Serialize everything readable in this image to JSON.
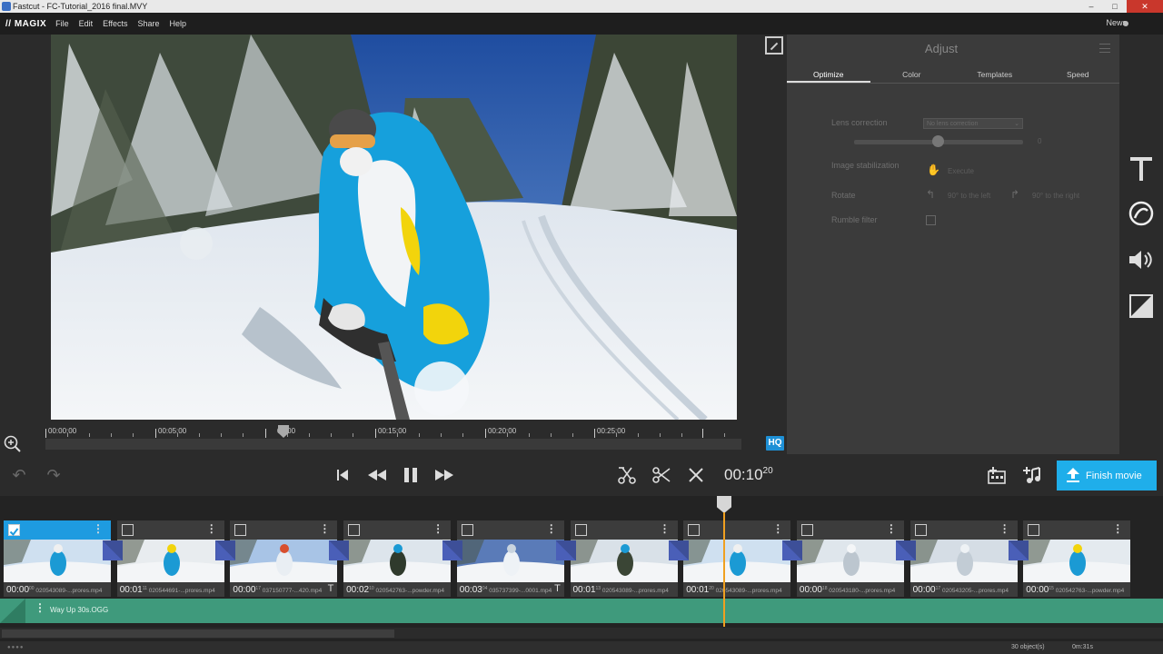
{
  "window": {
    "title": "Fastcut - FC-Tutorial_2016 final.MVY"
  },
  "menubar": {
    "logo": "// MAGIX",
    "items": [
      "File",
      "Edit",
      "Effects",
      "Share",
      "Help"
    ],
    "news": "News"
  },
  "preview": {
    "ruler_labels": [
      "00:00:00",
      "00:05:00",
      "00:00",
      "00:15:00",
      "00:20:00",
      "00:25:00"
    ],
    "hq_badge": "HQ"
  },
  "adjust": {
    "title": "Adjust",
    "tabs": [
      "Optimize",
      "Color",
      "Templates",
      "Speed"
    ],
    "lens_correction": {
      "label": "Lens correction",
      "value": "No lens correction",
      "slider_value": "0"
    },
    "image_stabilization": {
      "label": "Image stabilization",
      "action": "Execute"
    },
    "rotate": {
      "label": "Rotate",
      "left": "90° to the left",
      "right": "90° to the right"
    },
    "rumble_filter": {
      "label": "Rumble filter"
    }
  },
  "sidebar": {
    "icons": [
      "text-icon",
      "adjust-icon",
      "audio-icon",
      "effects-icon"
    ]
  },
  "transport": {
    "timecode_main": "00:10",
    "timecode_frames": "20",
    "finish_label": "Finish movie"
  },
  "timeline": {
    "clips": [
      {
        "time": "00:00",
        "frames": "00",
        "name": "020543089-...prores.mp4",
        "selected": true,
        "title_marker": false
      },
      {
        "time": "00:01",
        "frames": "11",
        "name": "020544691-...prores.mp4",
        "selected": false,
        "title_marker": false
      },
      {
        "time": "00:00",
        "frames": "17",
        "name": "037150777-...420.mp4",
        "selected": false,
        "title_marker": true
      },
      {
        "time": "00:02",
        "frames": "10",
        "name": "020542763-...powder.mp4",
        "selected": false,
        "title_marker": false
      },
      {
        "time": "00:03",
        "frames": "04",
        "name": "035737399-...0001.mp4",
        "selected": false,
        "title_marker": true
      },
      {
        "time": "00:01",
        "frames": "13",
        "name": "020543089-...prores.mp4",
        "selected": false,
        "title_marker": false
      },
      {
        "time": "00:01",
        "frames": "20",
        "name": "020543089-...prores.mp4",
        "selected": false,
        "title_marker": false
      },
      {
        "time": "00:00",
        "frames": "18",
        "name": "020543180-...prores.mp4",
        "selected": false,
        "title_marker": false
      },
      {
        "time": "00:00",
        "frames": "17",
        "name": "020543205-...prores.mp4",
        "selected": false,
        "title_marker": false
      },
      {
        "time": "00:00",
        "frames": "15",
        "name": "020542763-...powder.mp4",
        "selected": false,
        "title_marker": false
      }
    ],
    "audio_label": "Way Up 30s.OGG"
  },
  "status": {
    "objects": "30 object(s)",
    "duration": "0m:31s"
  }
}
